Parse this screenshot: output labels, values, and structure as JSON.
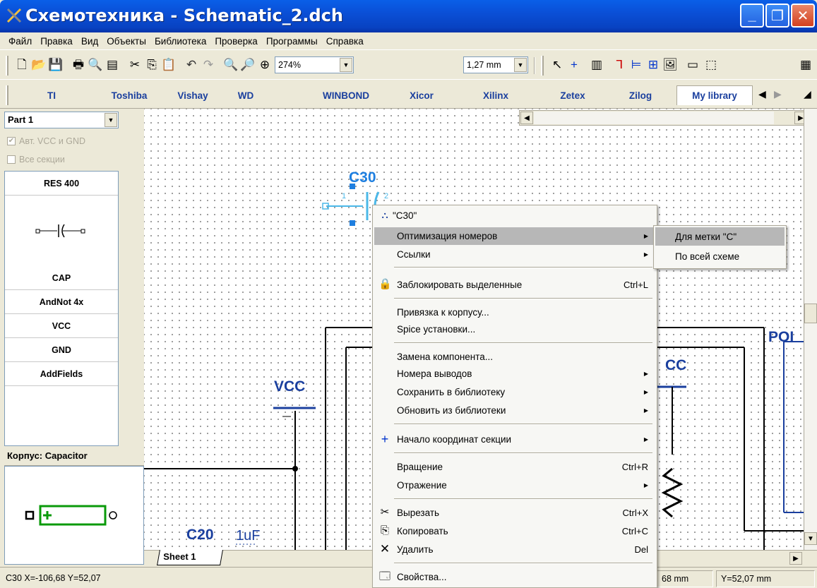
{
  "window": {
    "title": "Схемотехника - Schematic_2.dch"
  },
  "menu": [
    "Файл",
    "Правка",
    "Вид",
    "Объекты",
    "Библиотека",
    "Проверка",
    "Программы",
    "Справка"
  ],
  "toolbar": {
    "zoom": "274%",
    "grid": "1,27 mm"
  },
  "libraries": [
    "TI",
    "Toshiba",
    "Vishay",
    "WD",
    "WINBOND",
    "Xicor",
    "Xilinx",
    "Zetex",
    "Zilog",
    "My library"
  ],
  "left_panel": {
    "part": "Part 1",
    "auto_vcc_gnd": "Авт. VCC и GND",
    "all_sections": "Все секции",
    "components": [
      "RES 400",
      "CAP",
      "AndNot 4x",
      "VCC",
      "GND",
      "AddFields"
    ],
    "package_label": "Корпус: Capacitor"
  },
  "schematic": {
    "selected_ref": "C30",
    "pin1": "1",
    "pin2": "2",
    "vcc_label_left": "VCC",
    "vcc_label_right": "CC",
    "bottom_ref": "C20",
    "bottom_value": "1uF",
    "right_label": "POI"
  },
  "sheet_tab": "Sheet 1",
  "status": {
    "selection": "C30  X=-106,68  Y=52,07",
    "x": "68 mm",
    "y": "Y=52,07 mm"
  },
  "context_menu": {
    "header": "\"C30\"",
    "items": [
      {
        "label": "Оптимизация номеров",
        "submenu": true,
        "highlighted": true
      },
      {
        "label": "Ссылки",
        "submenu": true
      },
      {
        "label": "Заблокировать выделенные",
        "shortcut": "Ctrl+L",
        "icon": "lock-icon"
      },
      {
        "label": "Привязка к корпусу..."
      },
      {
        "label": "Spice установки..."
      },
      {
        "label": "Замена компонента..."
      },
      {
        "label": "Номера выводов",
        "submenu": true
      },
      {
        "label": "Сохранить в библиотеку",
        "submenu": true
      },
      {
        "label": "Обновить из библиотеки",
        "submenu": true
      },
      {
        "label": "Начало координат секции",
        "submenu": true,
        "icon": "origin-cross-icon"
      },
      {
        "label": "Вращение",
        "shortcut": "Ctrl+R"
      },
      {
        "label": "Отражение",
        "submenu": true
      },
      {
        "label": "Вырезать",
        "shortcut": "Ctrl+X",
        "icon": "scissors-icon"
      },
      {
        "label": "Копировать",
        "shortcut": "Ctrl+C",
        "icon": "copy-icon"
      },
      {
        "label": "Удалить",
        "shortcut": "Del",
        "icon": "delete-x-icon"
      },
      {
        "label": "Свойства...",
        "icon": "properties-icon"
      }
    ]
  },
  "submenu": [
    "Для метки \"C\"",
    "По всей схеме"
  ]
}
